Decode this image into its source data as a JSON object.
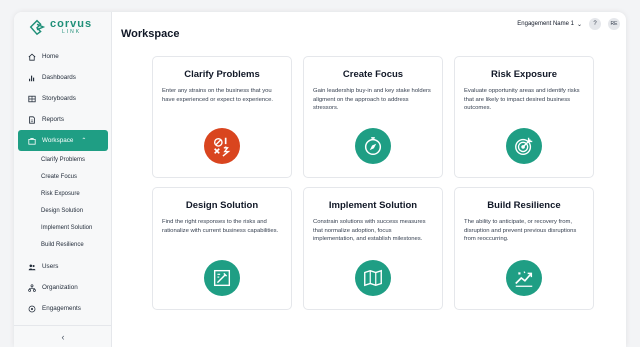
{
  "brand": {
    "name": "corvus",
    "sub": "LINK"
  },
  "sidebar": {
    "items": [
      {
        "label": "Home",
        "icon": "home-icon"
      },
      {
        "label": "Dashboards",
        "icon": "bar-chart-icon"
      },
      {
        "label": "Storyboards",
        "icon": "storyboard-icon"
      },
      {
        "label": "Reports",
        "icon": "document-icon"
      },
      {
        "label": "Workspace",
        "icon": "briefcase-icon",
        "active": true
      }
    ],
    "workspace_subitems": [
      "Clarify Problems",
      "Create Focus",
      "Risk Exposure",
      "Design Solution",
      "Implement Solution",
      "Build Resilience"
    ],
    "bottom_items": [
      {
        "label": "Users",
        "icon": "users-icon"
      },
      {
        "label": "Organization",
        "icon": "organization-icon"
      },
      {
        "label": "Engagements",
        "icon": "engagements-icon"
      }
    ],
    "collapse_icon": "‹"
  },
  "header": {
    "title": "Workspace",
    "engagement": "Engagement Name 1",
    "engagement_caret": "⌄",
    "help": "?",
    "avatar": "RE"
  },
  "cards": [
    {
      "title": "Clarify Problems",
      "desc": "Enter any strains on the business that you have experienced or expect to experience.",
      "icon": "problem-icon",
      "color": "#d9451f"
    },
    {
      "title": "Create Focus",
      "desc": "Gain leadership buy-in and key stake holders aligment on the approach to address stressors.",
      "icon": "compass-icon",
      "color": "#1f9e84"
    },
    {
      "title": "Risk Exposure",
      "desc": "Evaluate opportunity areas and identify risks that are likely to impact desired business outcomes.",
      "icon": "target-icon",
      "color": "#1f9e84"
    },
    {
      "title": "Design Solution",
      "desc": "Find the right responses to the risks and rationalize with current business capabilities.",
      "icon": "design-icon",
      "color": "#1f9e84"
    },
    {
      "title": "Implement Solution",
      "desc": "Constrain solutions with success measures that normalize adoption, focus implementation, and establish milestones.",
      "icon": "map-icon",
      "color": "#1f9e84"
    },
    {
      "title": "Build Resilience",
      "desc": "The ability to anticipate, or recovery from, disruption and prevent previous disruptions from reoccurring.",
      "icon": "resilience-icon",
      "color": "#1f9e84"
    }
  ]
}
